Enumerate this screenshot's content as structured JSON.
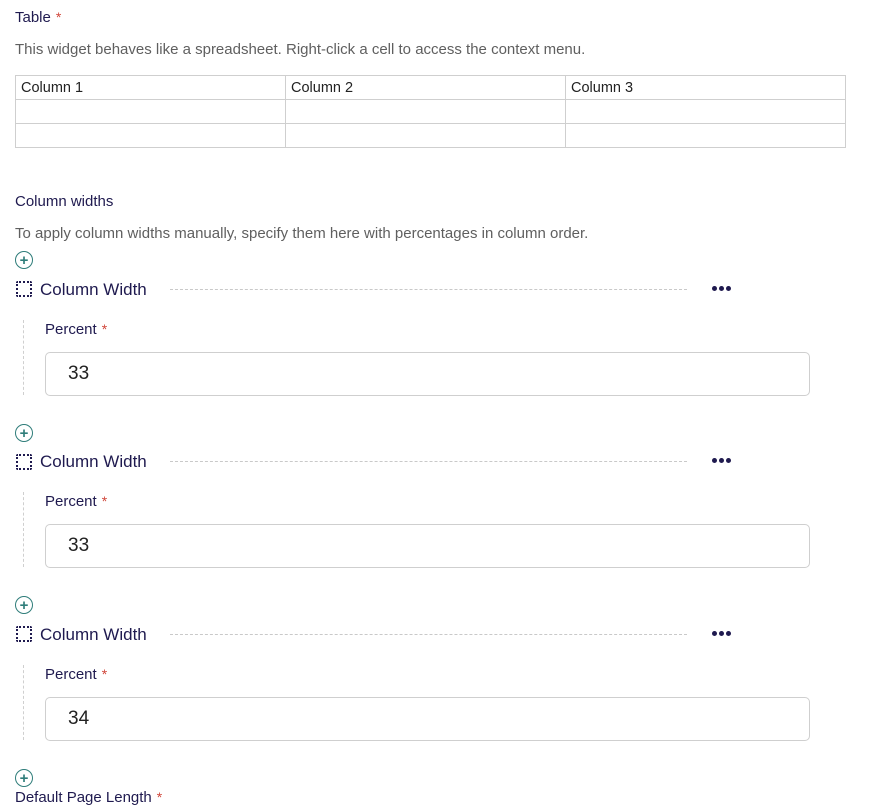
{
  "table_field": {
    "label": "Table",
    "required_mark": "*",
    "help": "This widget behaves like a spreadsheet. Right-click a cell to access the context menu.",
    "columns": [
      "Column 1",
      "Column 2",
      "Column 3"
    ],
    "rows": [
      [
        "",
        "",
        ""
      ],
      [
        "",
        "",
        ""
      ]
    ]
  },
  "column_widths": {
    "label": "Column widths",
    "help": "To apply column widths manually, specify them here with percentages in column order.",
    "items": [
      {
        "title": "Column Width",
        "field_label": "Percent",
        "required_mark": "*",
        "value": "33"
      },
      {
        "title": "Column Width",
        "field_label": "Percent",
        "required_mark": "*",
        "value": "33"
      },
      {
        "title": "Column Width",
        "field_label": "Percent",
        "required_mark": "*",
        "value": "34"
      }
    ],
    "add_icon": "plus-circle-icon",
    "drag_icon": "drag-handle-icon",
    "menu_icon": "more-horizontal-icon"
  },
  "default_page_length": {
    "label": "Default Page Length",
    "required_mark": "*"
  }
}
